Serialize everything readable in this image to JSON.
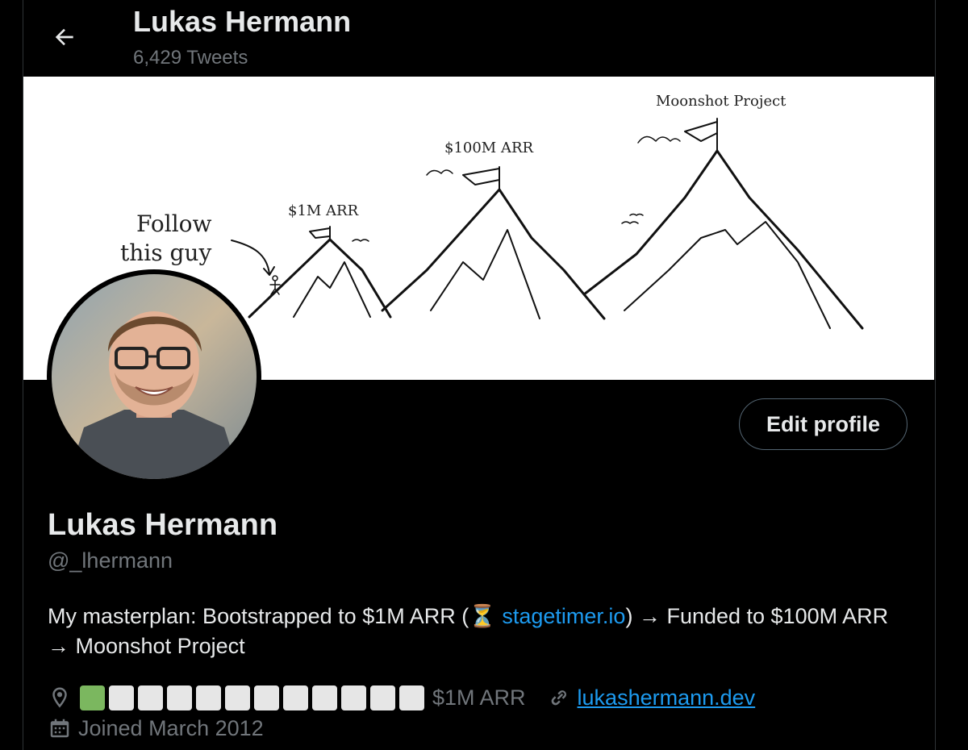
{
  "header": {
    "name": "Lukas Hermann",
    "tweet_count": "6,429 Tweets"
  },
  "banner": {
    "follow_text_line1": "Follow",
    "follow_text_line2": "this guy",
    "label_1m": "$1M ARR",
    "label_100m": "$100M ARR",
    "label_moonshot": "Moonshot Project"
  },
  "profile": {
    "edit_button": "Edit profile",
    "name": "Lukas Hermann",
    "handle": "@_lhermann",
    "bio_prefix": "My masterplan: Bootstrapped to $1M ARR (",
    "bio_hourglass": "⏳",
    "bio_link": "stagetimer.io",
    "bio_suffix": ") → Funded to $100M ARR → Moonshot Project",
    "progress_filled": 1,
    "progress_total": 12,
    "progress_label": "$1M ARR",
    "website": "lukashermann.dev",
    "joined": "Joined March 2012"
  },
  "icons": {
    "back": "arrow-left-icon",
    "location": "location-pin-icon",
    "link": "link-icon",
    "calendar": "calendar-icon"
  },
  "colors": {
    "background": "#000000",
    "text": "#e7e9ea",
    "muted": "#71767b",
    "link": "#1d9bf0",
    "progress_done": "#7bb75f",
    "progress_todo": "#e6e6e6"
  }
}
